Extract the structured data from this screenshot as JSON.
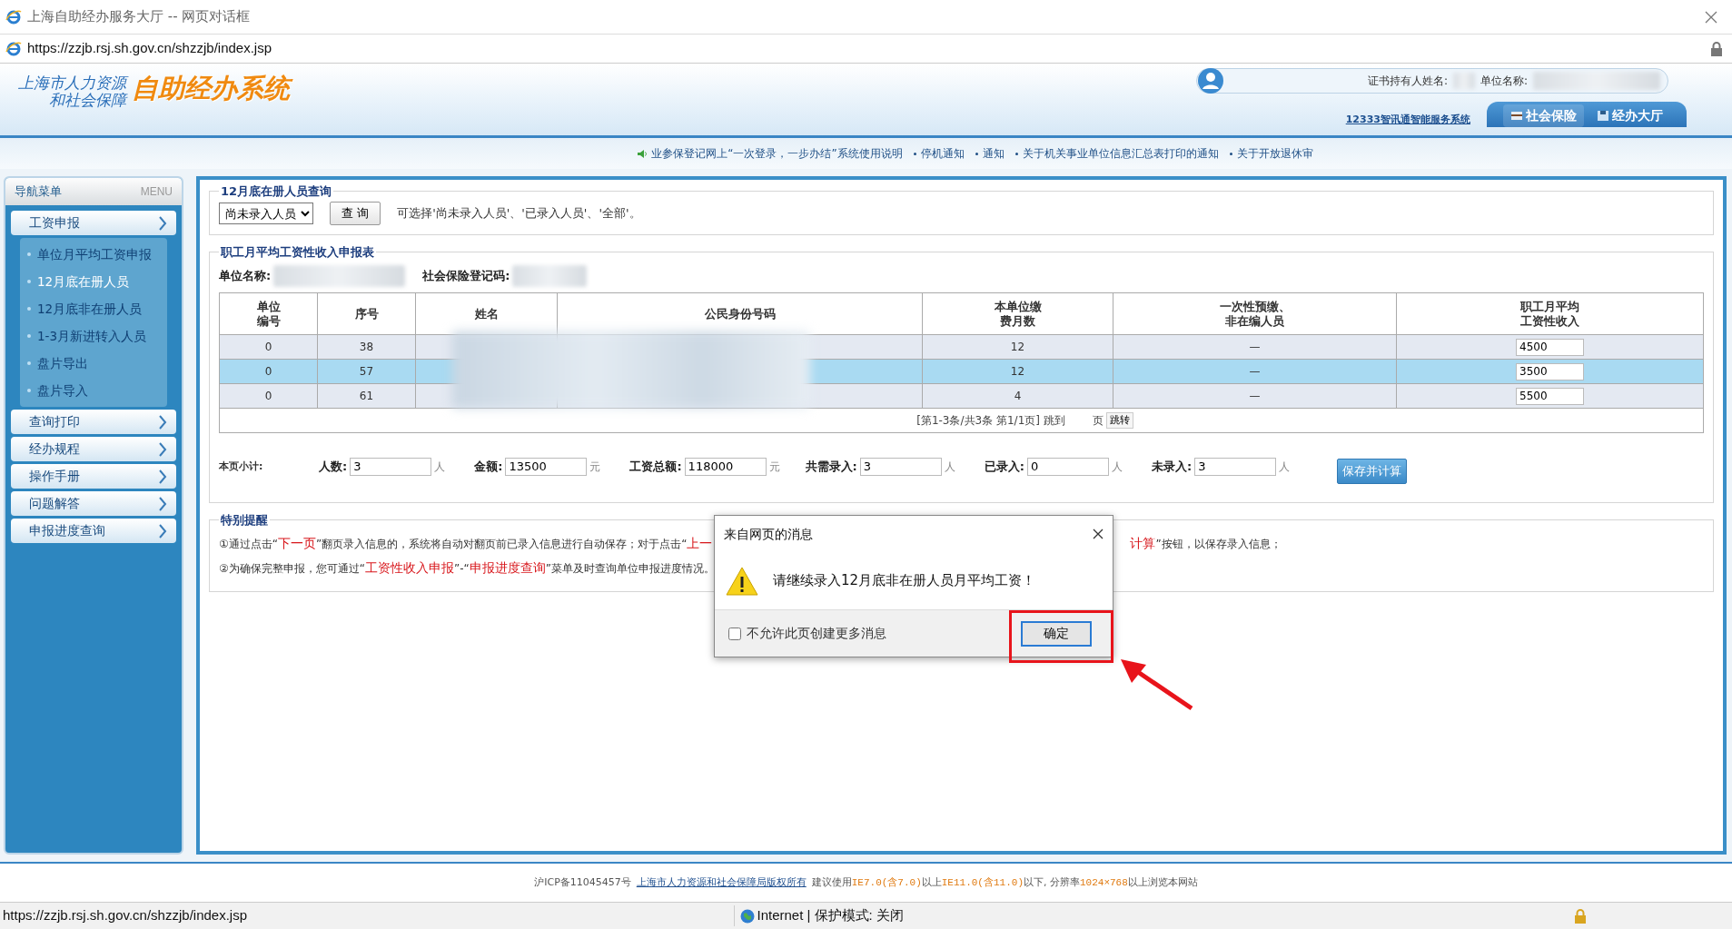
{
  "window": {
    "title": "上海自助经办服务大厅 -- 网页对话框",
    "address": "https://zzjb.rsj.sh.gov.cn/shzzjb/index.jsp"
  },
  "header": {
    "logo_line1": "上海市人力资源",
    "logo_line2": "和社会保障",
    "logo_main": "自助经办系统",
    "holder_label": "证书持有人姓名:",
    "unit_label": "单位名称:",
    "service_link": "12333智讯通智能服务系统",
    "tabs": [
      {
        "label": "社会保险",
        "selected": true
      },
      {
        "label": "经办大厅",
        "selected": false
      }
    ]
  },
  "notices": [
    "业参保登记网上“一次登录，一步办结”系统使用说明",
    "停机通知",
    "通知",
    "关于机关事业单位信息汇总表打印的通知",
    "关于开放退休审"
  ],
  "sidebar": {
    "title": "导航菜单",
    "menu_label": "MENU",
    "items": [
      {
        "label": "工资申报",
        "expanded": true,
        "children": [
          {
            "label": "单位月平均工资申报",
            "selected": false
          },
          {
            "label": "12月底在册人员",
            "selected": true
          },
          {
            "label": "12月底非在册人员",
            "selected": false
          },
          {
            "label": "1-3月新进转入人员",
            "selected": false
          },
          {
            "label": "盘片导出",
            "selected": false
          },
          {
            "label": "盘片导入",
            "selected": false
          }
        ]
      },
      {
        "label": "查询打印"
      },
      {
        "label": "经办规程"
      },
      {
        "label": "操作手册"
      },
      {
        "label": "问题解答"
      },
      {
        "label": "申报进度查询"
      }
    ]
  },
  "query": {
    "legend": "12月底在册人员查询",
    "select_value": "尚未录入人员",
    "button": "查 询",
    "hint": "可选择'尚未录入人员'、'已录入人员'、'全部'。"
  },
  "report": {
    "legend": "职工月平均工资性收入申报表",
    "unit_name_label": "单位名称:",
    "reg_code_label": "社会保险登记码:",
    "columns": [
      [
        "单位",
        "编号"
      ],
      [
        "序号"
      ],
      [
        "姓名"
      ],
      [
        "公民身份号码"
      ],
      [
        "本单位缴",
        "费月数"
      ],
      [
        "一次性预缴、",
        "非在编人员"
      ],
      [
        "职工月平均",
        "工资性收入"
      ]
    ],
    "rows": [
      {
        "unit_no": "0",
        "seq": "38",
        "months": "12",
        "one_time": "—",
        "income": "4500",
        "selected": false
      },
      {
        "unit_no": "0",
        "seq": "57",
        "months": "12",
        "one_time": "—",
        "income": "3500",
        "selected": true
      },
      {
        "unit_no": "0",
        "seq": "61",
        "months": "4",
        "one_time": "—",
        "income": "5500",
        "selected": false
      }
    ],
    "pager": {
      "info": "[第1-3条/共3条 第1/1页] 跳到",
      "page_unit": "页",
      "button": "跳转"
    },
    "subtotal": {
      "label": "本页小计:",
      "fields": [
        {
          "label": "人数:",
          "value": "3",
          "unit": "人"
        },
        {
          "label": "金额:",
          "value": "13500",
          "unit": "元"
        },
        {
          "label": "工资总额:",
          "value": "118000",
          "unit": "元"
        },
        {
          "label": "共需录入:",
          "value": "3",
          "unit": "人"
        },
        {
          "label": "已录入:",
          "value": "0",
          "unit": "人"
        },
        {
          "label": "未录入:",
          "value": "3",
          "unit": "人"
        }
      ],
      "button": "保存并计算"
    }
  },
  "notes": {
    "legend": "特别提醒",
    "line1_start": "①通过点击“**下一页**”翻页录入信息的，系统将自动对翻页前已录入信息进行自动保存；对于点击“**上一**",
    "line1_end": "**计算**”按钮，以保存录入信息；",
    "line2": "②为确保完整申报，您可通过“**工资性收入申报**”-“**申报进度查询**”菜单及时查询单位申报进度情况。"
  },
  "dialog": {
    "title": "来自网页的消息",
    "message": "请继续录入12月底非在册人员月平均工资！",
    "checkbox_label": "不允许此页创建更多消息",
    "checked": false,
    "ok": "确定"
  },
  "footer": {
    "icp": "沪ICP备11045457号",
    "copyright": "上海市人力资源和社会保障局版权所有",
    "advice": "建议使用**IE7.0(含7.0)**以上**IE11.0(含11.0)**以下, 分辨率**1024×768**以上浏览本网站"
  },
  "status_bar": {
    "url": "https://zzjb.rsj.sh.gov.cn/shzzjb/index.jsp",
    "zone": "Internet | 保护模式: 关闭"
  }
}
